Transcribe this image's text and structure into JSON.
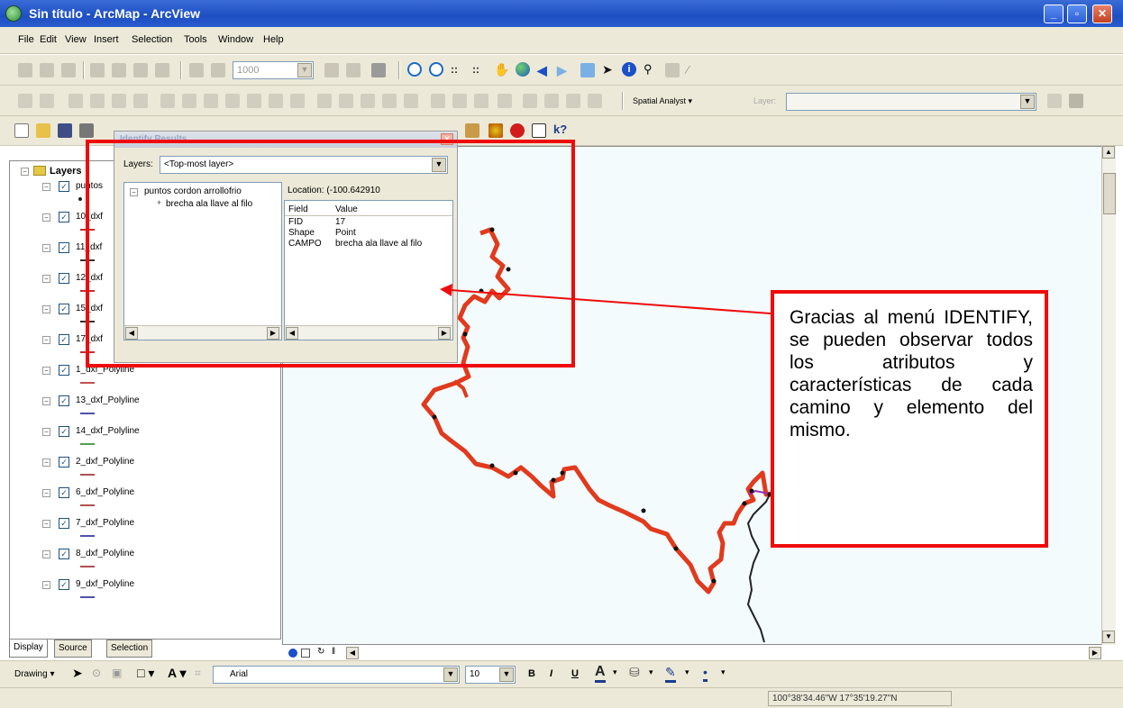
{
  "window": {
    "title": "Sin título - ArcMap - ArcView",
    "minimize": "_",
    "maximize": "▫",
    "close": "✕"
  },
  "menu": [
    "File",
    "Edit",
    "View",
    "Insert",
    "Selection",
    "Tools",
    "Window",
    "Help"
  ],
  "toolbar1": {
    "scale_value": "1000"
  },
  "toolbar2": {
    "spatial_analyst": "Spatial Analyst ▾",
    "layer_label": "Layer:"
  },
  "toc": {
    "root": "Layers",
    "layers": [
      {
        "name": "puntos",
        "color": "#333333"
      },
      {
        "name": "10_dxf",
        "color": "#cc2a2a"
      },
      {
        "name": "11_dxf",
        "color": "#333333"
      },
      {
        "name": "12_dxf",
        "color": "#cc2a2a"
      },
      {
        "name": "15_dxf",
        "color": "#333333"
      },
      {
        "name": "17_dxf",
        "color": "#cc2a2a"
      },
      {
        "name": "1_dxf_Polyline",
        "color": "#c05050"
      },
      {
        "name": "13_dxf_Polyline",
        "color": "#5050b0"
      },
      {
        "name": "14_dxf_Polyline",
        "color": "#50a050"
      },
      {
        "name": "2_dxf_Polyline",
        "color": "#b05050"
      },
      {
        "name": "6_dxf_Polyline",
        "color": "#b05050"
      },
      {
        "name": "7_dxf_Polyline",
        "color": "#5050b0"
      },
      {
        "name": "8_dxf_Polyline",
        "color": "#b05050"
      },
      {
        "name": "9_dxf_Polyline",
        "color": "#5050b0"
      }
    ],
    "tabs": [
      "Display",
      "Source",
      "Selection"
    ]
  },
  "identify": {
    "title": "Identify Results",
    "layers_label": "Layers:",
    "layers_value": "<Top-most layer>",
    "tree_root": "puntos cordon arrollofrio",
    "tree_child": "brecha ala llave al filo",
    "location": "Location: (-100.642910",
    "col_field": "Field",
    "col_value": "Value",
    "rows": [
      {
        "field": "FID",
        "value": "17"
      },
      {
        "field": "Shape",
        "value": "Point"
      },
      {
        "field": "CAMPO",
        "value": "brecha ala llave al filo"
      }
    ]
  },
  "annotation": {
    "text": "Gracias al menú IDENTIFY, se pueden observar todos los atributos y características de cada camino y elemento del mismo."
  },
  "drawing": {
    "drawing_label": "Drawing ▾",
    "font": "Arial",
    "size": "10",
    "bold": "B",
    "italic": "I",
    "underline": "U"
  },
  "status": {
    "coords": "100°38'34.46\"W  17°35'19.27\"N"
  }
}
